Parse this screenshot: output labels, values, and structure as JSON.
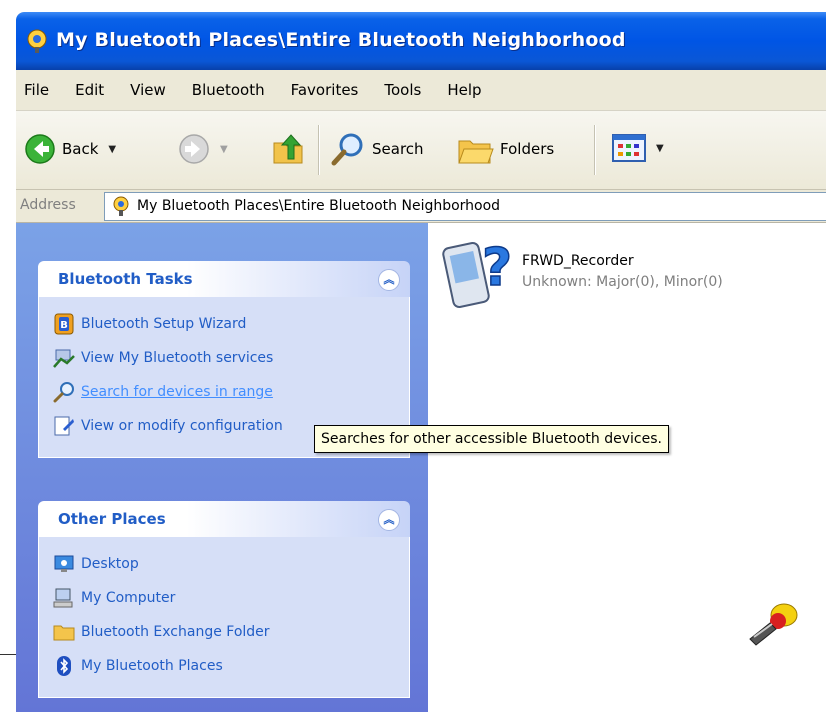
{
  "window": {
    "title": "My Bluetooth Places\\Entire Bluetooth Neighborhood",
    "title_icon": "bluetooth-places-icon"
  },
  "menu": [
    "File",
    "Edit",
    "View",
    "Bluetooth",
    "Favorites",
    "Tools",
    "Help"
  ],
  "toolbar": {
    "back_label": "Back",
    "search_label": "Search",
    "folders_label": "Folders"
  },
  "address": {
    "label": "Address",
    "value": "My Bluetooth Places\\Entire Bluetooth Neighborhood"
  },
  "panels": {
    "bluetooth_tasks": {
      "title": "Bluetooth Tasks",
      "items": [
        {
          "label": "Bluetooth Setup Wizard",
          "icon": "setup-wizard-icon"
        },
        {
          "label": "View My Bluetooth services",
          "icon": "services-icon"
        },
        {
          "label": "Search for devices in range",
          "icon": "search-icon"
        },
        {
          "label": "View or modify configuration",
          "icon": "configuration-icon"
        }
      ]
    },
    "other_places": {
      "title": "Other Places",
      "items": [
        {
          "label": "Desktop",
          "icon": "desktop-icon"
        },
        {
          "label": "My Computer",
          "icon": "my-computer-icon"
        },
        {
          "label": "Bluetooth Exchange Folder",
          "icon": "folder-icon"
        },
        {
          "label": "My Bluetooth Places",
          "icon": "bluetooth-icon"
        }
      ]
    }
  },
  "device": {
    "name": "FRWD_Recorder",
    "description": "Unknown: Major(0), Minor(0)",
    "icon": "unknown-device-icon"
  },
  "tooltip": "Searches for other accessible Bluetooth devices.",
  "colors": {
    "titlebar": "#0055e5",
    "task_link": "#215dc6",
    "taskpane": "#6f8edf"
  }
}
